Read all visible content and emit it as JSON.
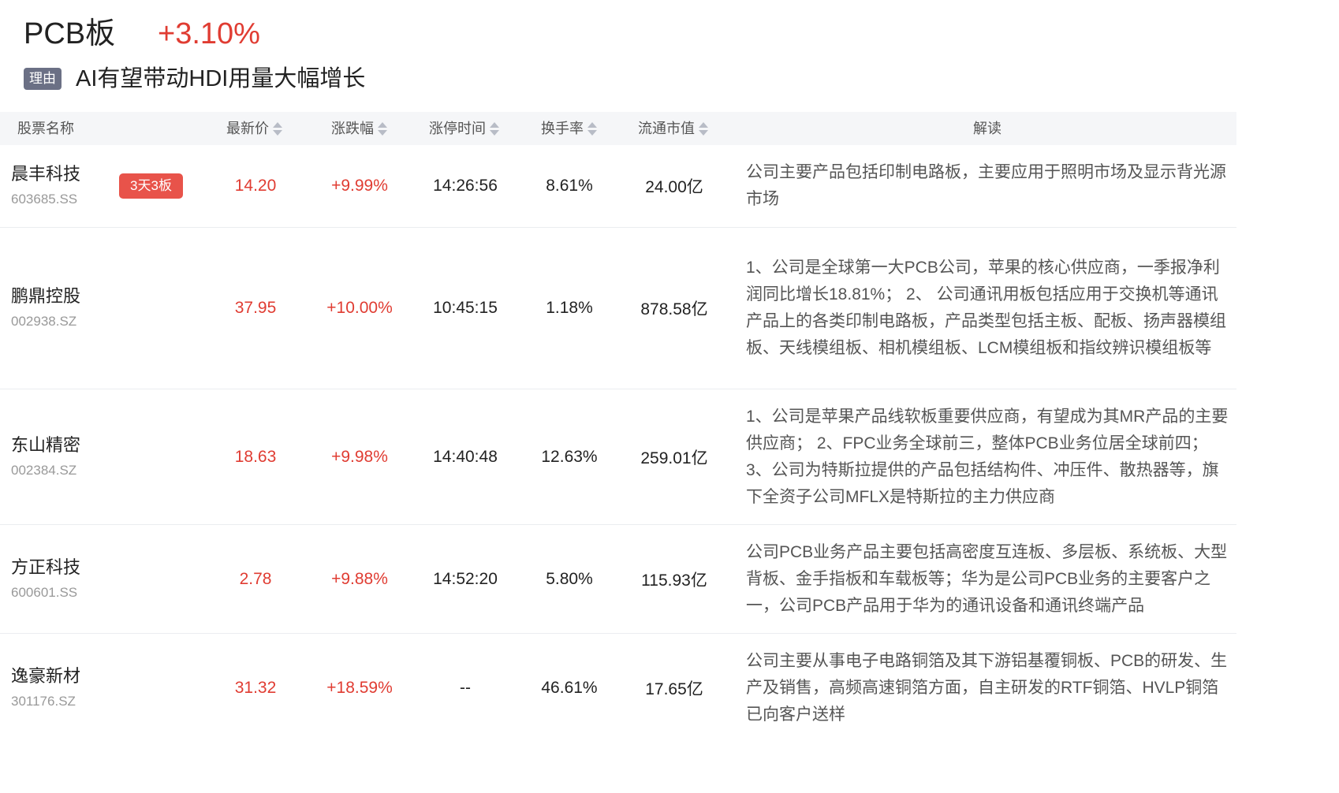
{
  "header": {
    "title": "PCB板",
    "change": "+3.10%",
    "reason_tag": "理由",
    "reason_text": "AI有望带动HDI用量大幅增长"
  },
  "table": {
    "columns": {
      "name": "股票名称",
      "price": "最新价",
      "pct": "涨跌幅",
      "limit_time": "涨停时间",
      "turnover": "换手率",
      "mcap": "流通市值",
      "desc": "解读"
    },
    "rows": [
      {
        "name": "晨丰科技",
        "code": "603685.SS",
        "badge": "3天3板",
        "price": "14.20",
        "pct": "+9.99%",
        "limit_time": "14:26:56",
        "turnover": "8.61%",
        "mcap": "24.00亿",
        "desc": "公司主要产品包括印制电路板，主要应用于照明市场及显示背光源市场"
      },
      {
        "name": "鹏鼎控股",
        "code": "002938.SZ",
        "badge": "",
        "price": "37.95",
        "pct": "+10.00%",
        "limit_time": "10:45:15",
        "turnover": "1.18%",
        "mcap": "878.58亿",
        "desc": "1、公司是全球第一大PCB公司，苹果的核心供应商，一季报净利润同比增长18.81%； 2、 公司通讯用板包括应用于交换机等通讯产品上的各类印制电路板，产品类型包括主板、配板、扬声器模组板、天线模组板、相机模组板、LCM模组板和指纹辨识模组板等"
      },
      {
        "name": "东山精密",
        "code": "002384.SZ",
        "badge": "",
        "price": "18.63",
        "pct": "+9.98%",
        "limit_time": "14:40:48",
        "turnover": "12.63%",
        "mcap": "259.01亿",
        "desc": "1、公司是苹果产品线软板重要供应商，有望成为其MR产品的主要供应商； 2、FPC业务全球前三，整体PCB业务位居全球前四； 3、公司为特斯拉提供的产品包括结构件、冲压件、散热器等，旗下全资子公司MFLX是特斯拉的主力供应商"
      },
      {
        "name": "方正科技",
        "code": "600601.SS",
        "badge": "",
        "price": "2.78",
        "pct": "+9.88%",
        "limit_time": "14:52:20",
        "turnover": "5.80%",
        "mcap": "115.93亿",
        "desc": "公司PCB业务产品主要包括高密度互连板、多层板、系统板、大型背板、金手指板和车载板等；华为是公司PCB业务的主要客户之一，公司PCB产品用于华为的通讯设备和通讯终端产品"
      },
      {
        "name": "逸豪新材",
        "code": "301176.SZ",
        "badge": "",
        "price": "31.32",
        "pct": "+18.59%",
        "limit_time": "--",
        "turnover": "46.61%",
        "mcap": "17.65亿",
        "desc": "公司主要从事电子电路铜箔及其下游铝基覆铜板、PCB的研发、生产及销售，高频高速铜箔方面，自主研发的RTF铜箔、HVLP铜箔已向客户送样"
      }
    ]
  },
  "colors": {
    "up": "#e03c32",
    "badge_bg": "#e8534a",
    "tag_bg": "#6b7085",
    "header_bg": "#f5f6f8"
  }
}
